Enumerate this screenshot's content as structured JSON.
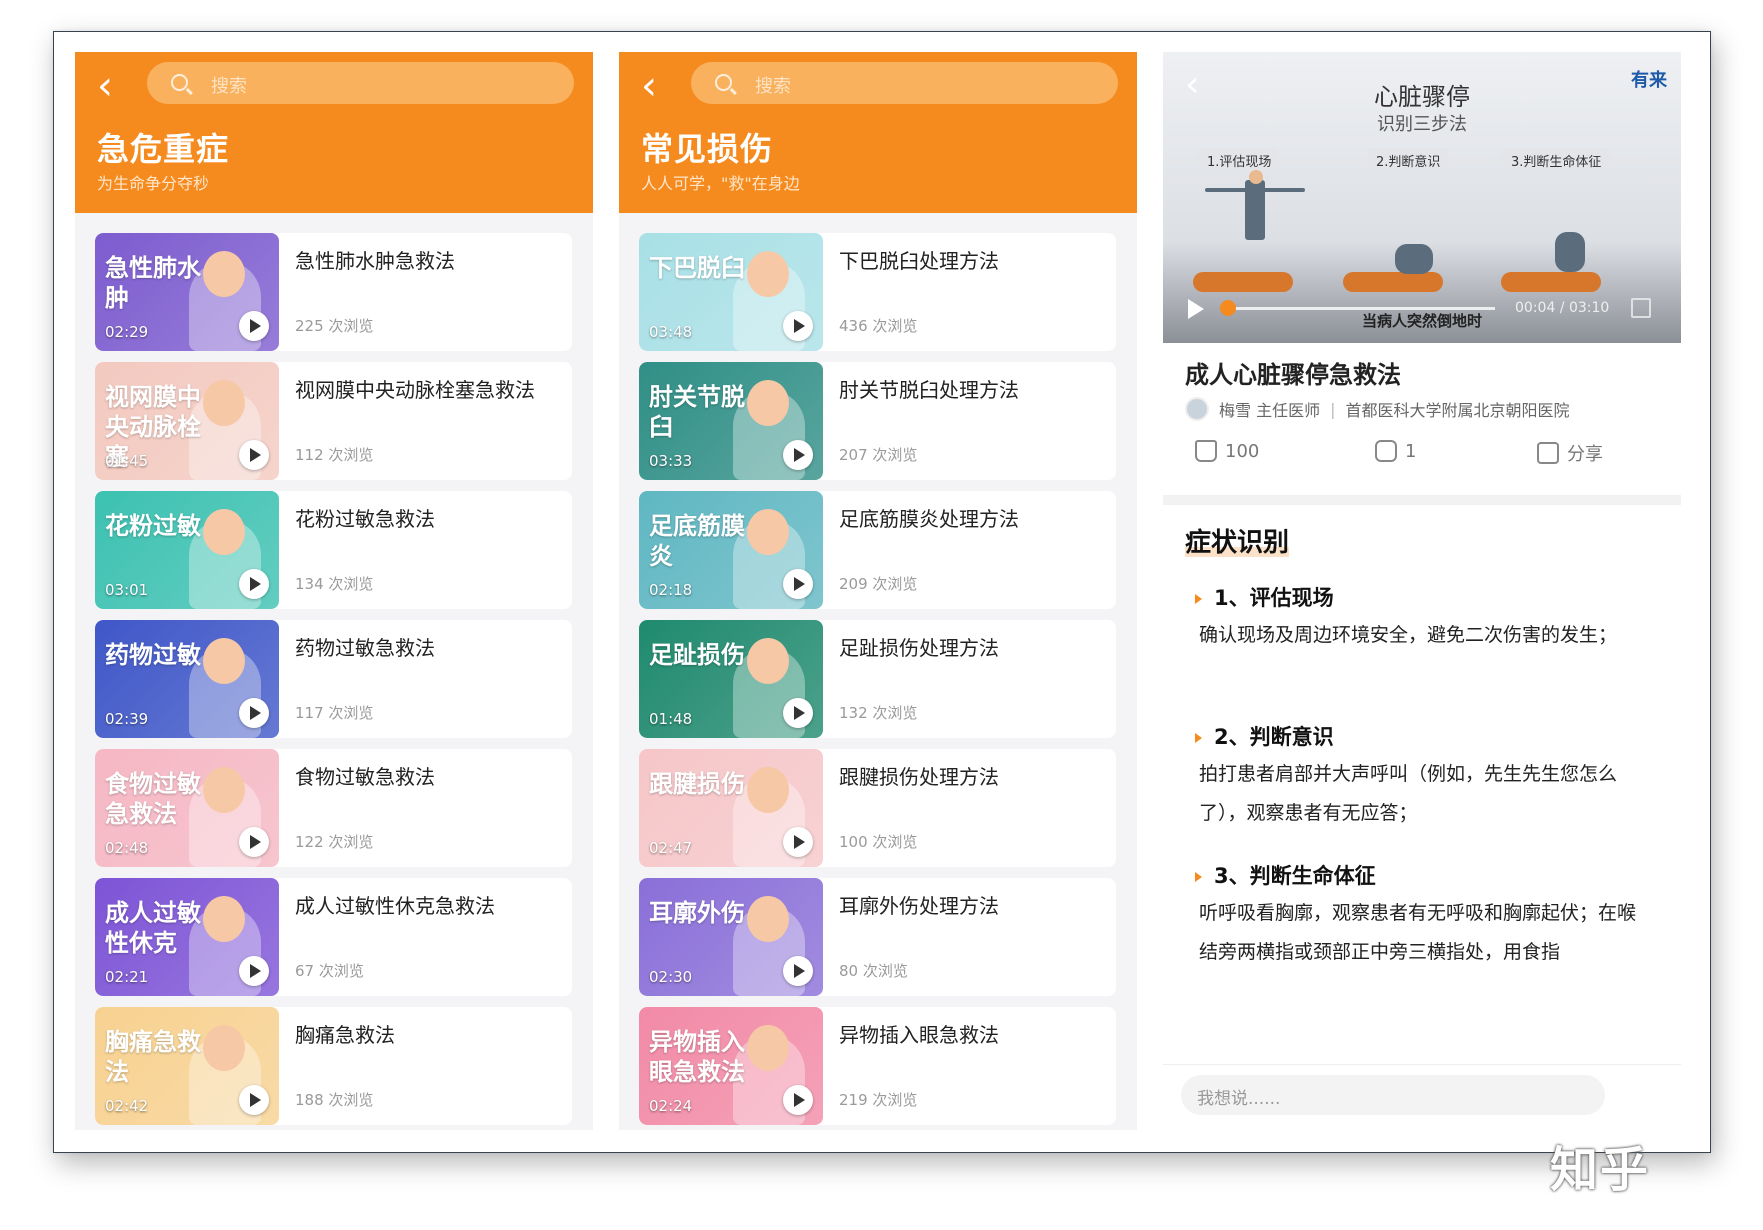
{
  "panel1": {
    "search_placeholder": "搜索",
    "title": "急危重症",
    "subtitle": "为生命争分夺秒",
    "items": [
      {
        "title": "急性肺水肿急救法",
        "views": "225 次浏览",
        "duration": "02:29",
        "thumb_text": "急性肺水肿",
        "thumb_color": "#7d5ccf"
      },
      {
        "title": "视网膜中央动脉栓塞急救法",
        "views": "112 次浏览",
        "duration": "01:45",
        "thumb_text": "视网膜中央动脉栓塞",
        "thumb_color": "#f3c9bf"
      },
      {
        "title": "花粉过敏急救法",
        "views": "134 次浏览",
        "duration": "03:01",
        "thumb_text": "花粉过敏",
        "thumb_color": "#3cc1b1"
      },
      {
        "title": "药物过敏急救法",
        "views": "117 次浏览",
        "duration": "02:39",
        "thumb_text": "药物过敏",
        "thumb_color": "#3f57c8"
      },
      {
        "title": "食物过敏急救法",
        "views": "122 次浏览",
        "duration": "02:48",
        "thumb_text": "食物过敏急救法",
        "thumb_color": "#f5b7c3"
      },
      {
        "title": "成人过敏性休克急救法",
        "views": "67 次浏览",
        "duration": "02:21",
        "thumb_text": "成人过敏性休克",
        "thumb_color": "#7d54d6"
      },
      {
        "title": "胸痛急救法",
        "views": "188 次浏览",
        "duration": "02:42",
        "thumb_text": "胸痛急救法",
        "thumb_color": "#f7d190"
      }
    ]
  },
  "panel2": {
    "search_placeholder": "搜索",
    "title": "常见损伤",
    "subtitle": "人人可学，\"救\"在身边",
    "items": [
      {
        "title": "下巴脱臼处理方法",
        "views": "436 次浏览",
        "duration": "03:48",
        "thumb_text": "下巴脱臼",
        "thumb_color": "#a8e0e6"
      },
      {
        "title": "肘关节脱臼处理方法",
        "views": "207 次浏览",
        "duration": "03:33",
        "thumb_text": "肘关节脱臼",
        "thumb_color": "#2f8f86"
      },
      {
        "title": "足底筋膜炎处理方法",
        "views": "209 次浏览",
        "duration": "02:18",
        "thumb_text": "足底筋膜炎",
        "thumb_color": "#5fb7c2"
      },
      {
        "title": "足趾损伤处理方法",
        "views": "132 次浏览",
        "duration": "01:48",
        "thumb_text": "足趾损伤",
        "thumb_color": "#1f8a6e"
      },
      {
        "title": "跟腱损伤处理方法",
        "views": "100 次浏览",
        "duration": "02:47",
        "thumb_text": "跟腱损伤",
        "thumb_color": "#f6c6c8"
      },
      {
        "title": "耳廓外伤处理方法",
        "views": "80 次浏览",
        "duration": "02:30",
        "thumb_text": "耳廓外伤",
        "thumb_color": "#8a6fd8"
      },
      {
        "title": "异物插入眼急救法",
        "views": "219 次浏览",
        "duration": "02:24",
        "thumb_text": "异物插入眼急救法",
        "thumb_color": "#f28aa6"
      }
    ]
  },
  "panel3": {
    "video": {
      "title": "心脏骤停",
      "subtitle": "识别三步法",
      "logo": "有来",
      "steps": [
        "1.评估现场",
        "2.判断意识",
        "3.判断生命体征"
      ],
      "caption": "当病人突然倒地时",
      "time": "00:04 / 03:10",
      "progress": 0.02
    },
    "article_title": "成人心脏骤停急救法",
    "author_name": "梅雪",
    "author_title": "主任医师",
    "author_org": "首都医科大学附属北京朝阳医院",
    "likes": "100",
    "comments": "1",
    "share_label": "分享",
    "section_title": "症状识别",
    "sub1_title": "1、评估现场",
    "sub1_text": "确认现场及周边环境安全，避免二次伤害的发生；",
    "sub2_title": "2、判断意识",
    "sub2_text": "拍打患者肩部并大声呼叫（例如，先生先生您怎么了），观察患者有无应答；",
    "sub3_title": "3、判断生命体征",
    "sub3_text": "听呼吸看胸廓，观察患者有无呼吸和胸廓起伏；在喉结旁两横指或颈部正中旁三横指处，用食指",
    "comment_placeholder": "我想说......"
  },
  "watermark": "知乎",
  "colors": {
    "accent": "#f58a1f",
    "link_blue": "#1e5aa8"
  }
}
